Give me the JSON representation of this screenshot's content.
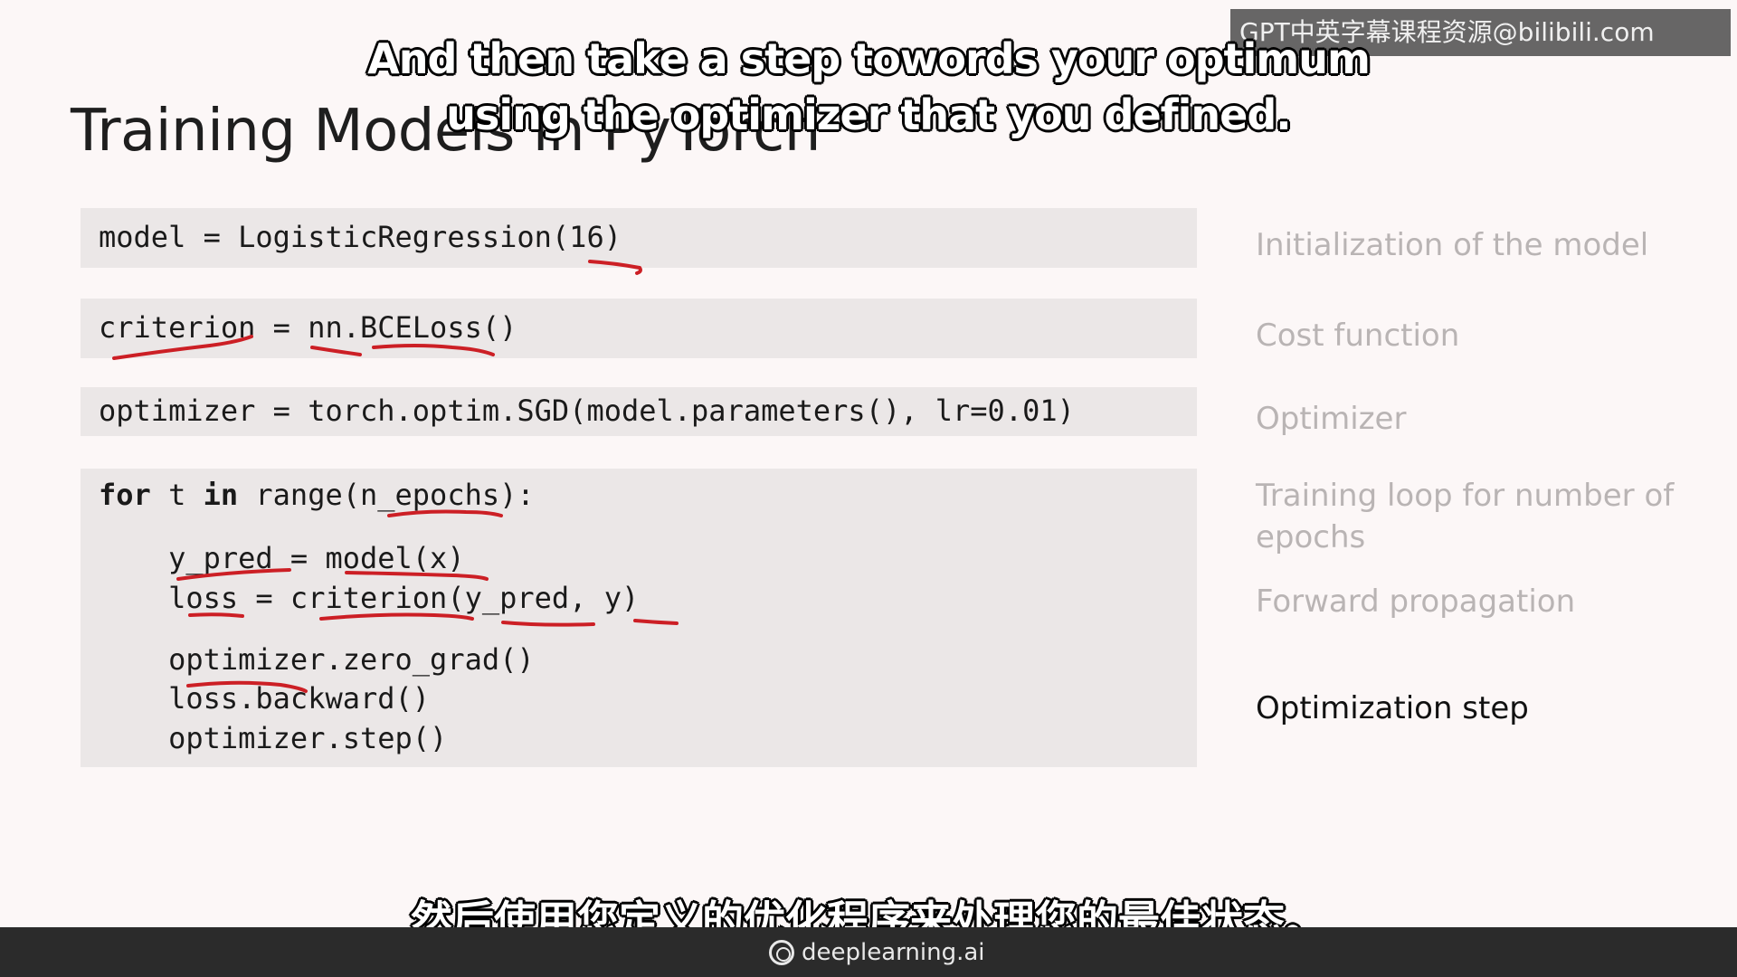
{
  "slide": {
    "title": "Training Models in PyTorch",
    "code": {
      "init_line": "model = LogisticRegression(16)",
      "criterion_line": "criterion = nn.BCELoss()",
      "optimizer_line": "optimizer = torch.optim.SGD(model.parameters(), lr=0.01)",
      "loop_kw_for": "for",
      "loop_var": " t ",
      "loop_kw_in": "in",
      "loop_rest": " range(n_epochs):",
      "forward_line_1": "    y_pred = model(x)",
      "forward_line_2": "    loss = criterion(y_pred, y)",
      "step_line_1": "    optimizer.zero_grad()",
      "step_line_2": "    loss.backward()",
      "step_line_3": "    optimizer.step()"
    },
    "descriptions": {
      "init": "Initialization of the model",
      "cost": "Cost function",
      "optimizer": "Optimizer",
      "loop": "Training loop for number of epochs",
      "forward": "Forward propagation",
      "step": "Optimization step"
    },
    "active_description": "step",
    "annotation_color": "#cc1f25"
  },
  "overlay": {
    "watermark": "GPT中英字幕课程资源@bilibili.com",
    "subtitle_en_line1": "And then take a step towords your optimum",
    "subtitle_en_line2": "using the optimizer that you defined.",
    "subtitle_cn": "然后使用您定义的优化程序来处理您的最佳状态。"
  },
  "footer": {
    "brand": "deeplearning.ai",
    "logo_icon": "deeplearning-logo-icon"
  }
}
